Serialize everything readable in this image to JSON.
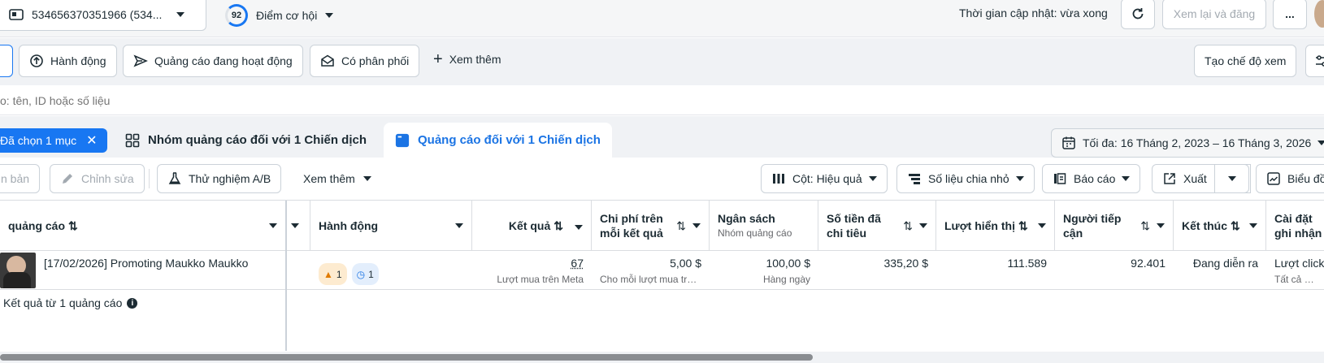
{
  "header": {
    "account_label": "534656370351966 (534...",
    "score_value": "92",
    "score_label": "Điểm cơ hội",
    "update_status": "Thời gian cập nhật: vừa xong",
    "review_publish_label": "Xem lại và đăng",
    "more_label": "..."
  },
  "filters": {
    "items": [
      "Hành động",
      "Quảng cáo đang hoạt động",
      "Có phân phối"
    ],
    "see_more": "Xem thêm",
    "create_view": "Tạo chế độ xem"
  },
  "search": {
    "placeholder": "o: tên, ID hoặc số liệu"
  },
  "tabs": {
    "selected_chip": "Đã chọn 1 mục",
    "adsets_tab": "Nhóm quảng cáo đối với 1 Chiến dịch",
    "ads_tab": "Quảng cáo đối với 1 Chiến dịch",
    "date_range": "Tối đa: 16 Tháng 2, 2023 – 16 Tháng 3, 2026"
  },
  "toolbar": {
    "duplicate_label": "n bản",
    "edit_label": "Chỉnh sửa",
    "ab_test_label": "Thử nghiệm A/B",
    "see_more_label": "Xem thêm",
    "columns_label": "Cột: Hiệu quả",
    "breakdown_label": "Số liệu chia nhỏ",
    "reports_label": "Báo cáo",
    "export_label": "Xuất",
    "charts_label": "Biểu đồ"
  },
  "table": {
    "headers": {
      "ad": "quảng cáo",
      "actions": "Hành động",
      "results": "Kết quả",
      "cost_per_result": "Chi phí trên mỗi kết quả",
      "budget": "Ngân sách",
      "budget_sub": "Nhóm quảng cáo",
      "amount_spent": "Số tiền đã chi tiêu",
      "impressions": "Lượt hiển thị",
      "reach": "Người tiếp cận",
      "ends": "Kết thúc",
      "attribution": "Cài đặt ghi nhận"
    },
    "row": {
      "ad_name": "[17/02/2026] Promoting Maukko Maukko",
      "warnings": "1",
      "info": "1",
      "results": "67",
      "results_sub": "Lượt mua trên Meta",
      "cost_per_result": "5,00 $",
      "cost_sub": "Cho mỗi lượt mua trên...",
      "budget": "100,00 $",
      "budget_sub": "Hàng ngày",
      "amount_spent": "335,20 $",
      "impressions": "111.589",
      "reach": "92.401",
      "ends": "Đang diễn ra",
      "attribution": "Lượt click",
      "attribution_sub": "Tất cả lượt c"
    },
    "summary": "Kết quả từ 1 quảng cáo"
  },
  "colors": {
    "primary": "#1877f2",
    "tab_active_text": "#1b74e4",
    "warning": "#f7a325"
  }
}
